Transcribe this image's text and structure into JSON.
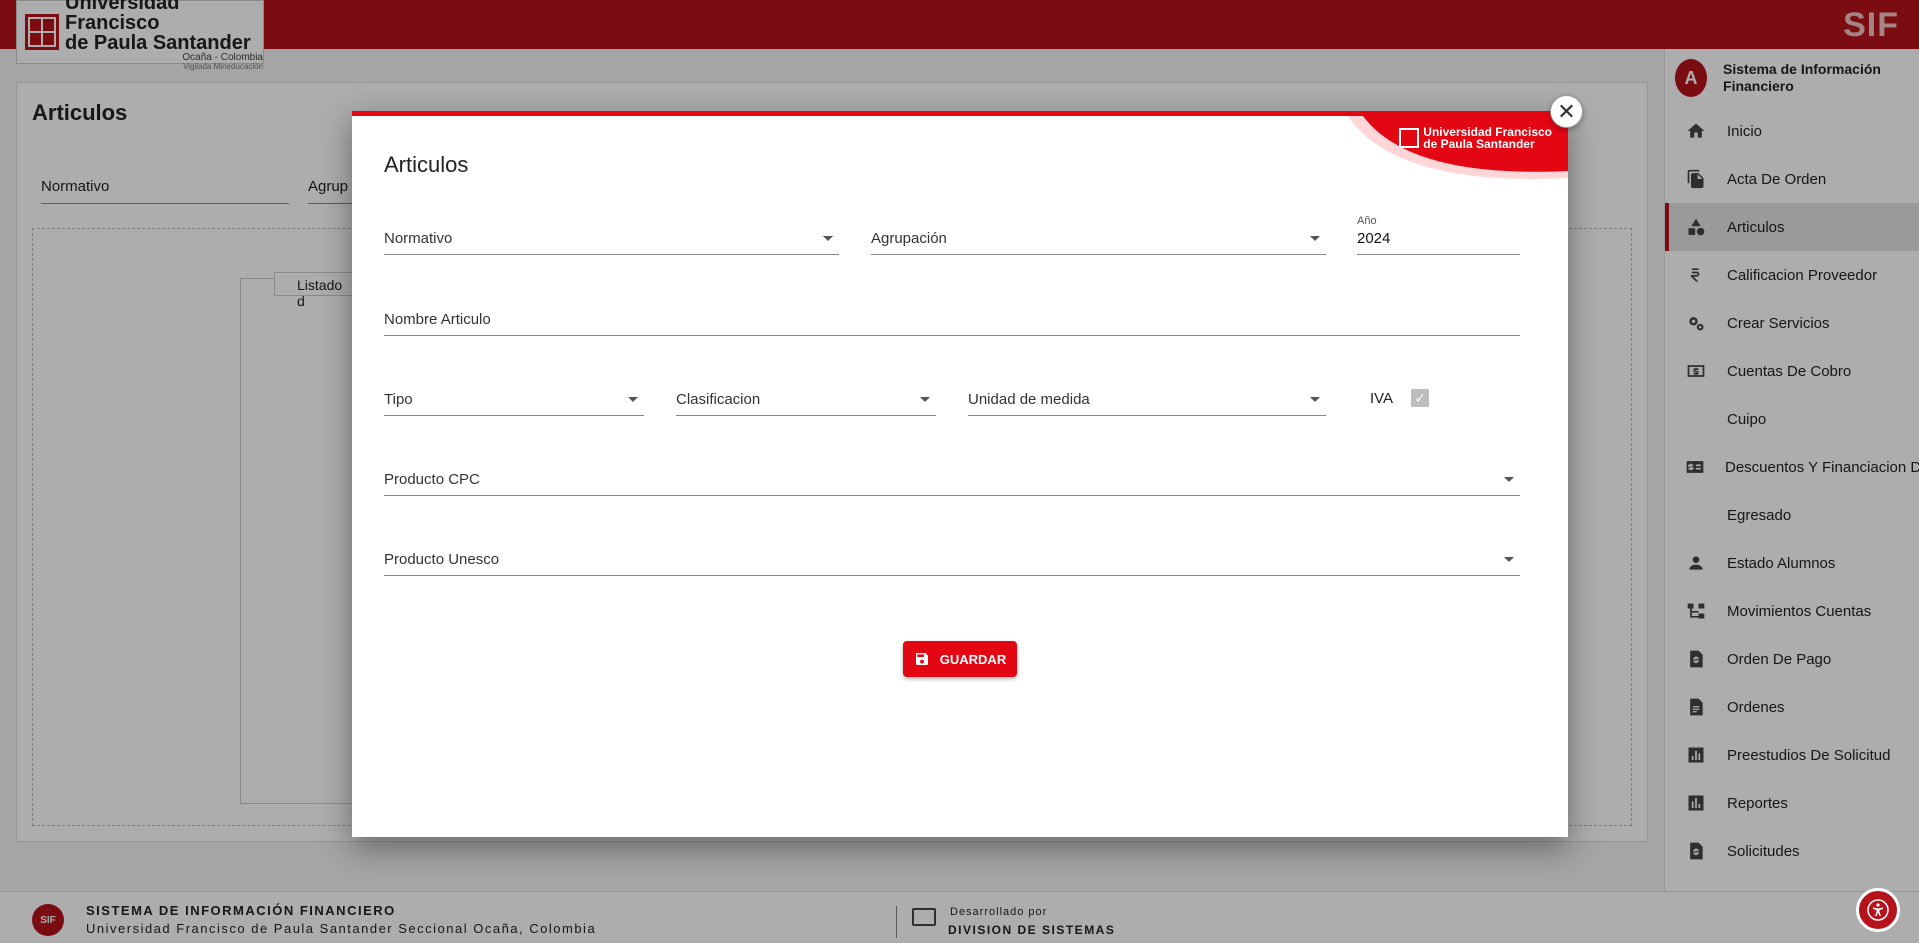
{
  "header": {
    "logo_line1": "Universidad Francisco",
    "logo_line2": "de Paula Santander",
    "logo_line3": "Ocaña - Colombia",
    "logo_line4": "Vigilada Mineducación",
    "brand": "SIF"
  },
  "page": {
    "title": "Articulos",
    "filter_normativo": "Normativo",
    "filter_agrupacion": "Agrup",
    "tab_label": "Listado d"
  },
  "sidebar": {
    "avatar_letter": "A",
    "title": "Sistema de Información Financiero",
    "items": [
      {
        "label": "Inicio",
        "icon": "home-icon"
      },
      {
        "label": "Acta De Orden",
        "icon": "document-copy-icon"
      },
      {
        "label": "Articulos",
        "icon": "shapes-icon"
      },
      {
        "label": "Calificacion Proveedor",
        "icon": "currency-icon"
      },
      {
        "label": "Crear Servicios",
        "icon": "gears-icon"
      },
      {
        "label": "Cuentas De Cobro",
        "icon": "cash-icon"
      },
      {
        "label": "Cuipo",
        "icon": ""
      },
      {
        "label": "Descuentos Y Financiacion D",
        "icon": "money-list-icon"
      },
      {
        "label": "Egresado",
        "icon": ""
      },
      {
        "label": "Estado Alumnos",
        "icon": "person-icon"
      },
      {
        "label": "Movimientos Cuentas",
        "icon": "tree-icon"
      },
      {
        "label": "Orden De Pago",
        "icon": "invoice-icon"
      },
      {
        "label": "Ordenes",
        "icon": "file-lines-icon"
      },
      {
        "label": "Preestudios De Solicitud",
        "icon": "chart-icon"
      },
      {
        "label": "Reportes",
        "icon": "bar-chart-icon"
      },
      {
        "label": "Solicitudes",
        "icon": "invoice-icon"
      }
    ]
  },
  "modal": {
    "title": "Articulos",
    "corner_logo_line1": "Universidad Francisco",
    "corner_logo_line2": "de Paula Santander",
    "normativo_label": "Normativo",
    "agrupacion_label": "Agrupación",
    "anio_label": "Año",
    "anio_value": "2024",
    "nombre_label": "Nombre Articulo",
    "tipo_label": "Tipo",
    "clasificacion_label": "Clasificacion",
    "unidad_label": "Unidad de medida",
    "iva_label": "IVA",
    "cpc_label": "Producto CPC",
    "unesco_label": "Producto Unesco",
    "save_label": "GUARDAR"
  },
  "footer": {
    "line1": "SISTEMA DE INFORMACIÓN FINANCIERO",
    "line2": "Universidad Francisco de Paula Santander Seccional Ocaña, Colombia",
    "dev_line1": "Desarrollado por",
    "dev_line2": "DIVISION DE SISTEMAS",
    "logo_text": "SIF"
  },
  "colors": {
    "primary_red": "#b5121b",
    "accent_red": "#e30613"
  }
}
